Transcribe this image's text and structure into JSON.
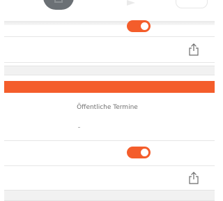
{
  "sections": [
    {
      "name": "",
      "toggle": {
        "state": "on"
      },
      "share_icon": "share-icon"
    },
    {
      "name": "Öffentliche Termine",
      "value": "-",
      "toggle": {
        "state": "on"
      },
      "share_icon": "share-icon"
    }
  ],
  "colors": {
    "accent": "#f45d2b",
    "divider": "#e6e6e6",
    "band": "#f1f1f1",
    "text": "#707070"
  }
}
